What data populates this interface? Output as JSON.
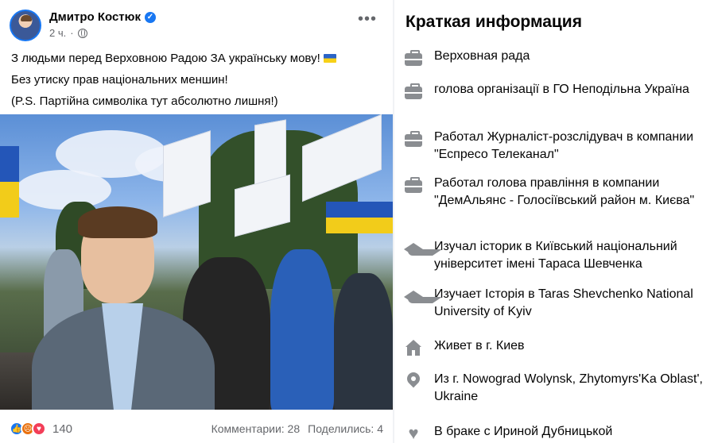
{
  "post": {
    "author": "Дмитро Костюк",
    "time": "2 ч.",
    "lines": [
      "З людьми перед Верховною Радою ЗА українську мову!",
      "Без утиску прав національних меншин!",
      "(P.S. Партійна символіка тут абсолютно лишня!)"
    ],
    "reactions_count": "140",
    "comments": "Комментарии: 28",
    "shares": "Поделились: 4"
  },
  "info": {
    "title": "Краткая информация",
    "items": [
      {
        "icon": "briefcase-icon",
        "text": "Верховная рада"
      },
      {
        "icon": "briefcase-icon",
        "text": "голова організації в ГО Неподільна Україна"
      },
      {
        "icon": "briefcase-icon",
        "text": "Работал Журналіст-розслідувач в компании \"Еспресо Телеканал\""
      },
      {
        "icon": "briefcase-icon",
        "text": "Работал голова правління в компании \"ДемАльянс - Голосіївський район м. Києва\""
      },
      {
        "icon": "graduation-cap-icon",
        "text": "Изучал історик в Київський національний університет імені Тараса Шевченка"
      },
      {
        "icon": "graduation-cap-icon",
        "text": "Изучает Історія в Taras Shevchenko National University of Kyiv"
      },
      {
        "icon": "home-icon",
        "text": "Живет в г. Киев"
      },
      {
        "icon": "location-pin-icon",
        "text": "Из г. Nowograd Wolynsk, Zhytomyrs'Ka Oblast', Ukraine"
      },
      {
        "icon": "heart-icon",
        "text": "В браке с Ириной Дубницькой"
      }
    ]
  },
  "colors": {
    "accent": "#1877f2",
    "secondary_text": "#65676b",
    "icon_gray": "#8a8d91"
  }
}
